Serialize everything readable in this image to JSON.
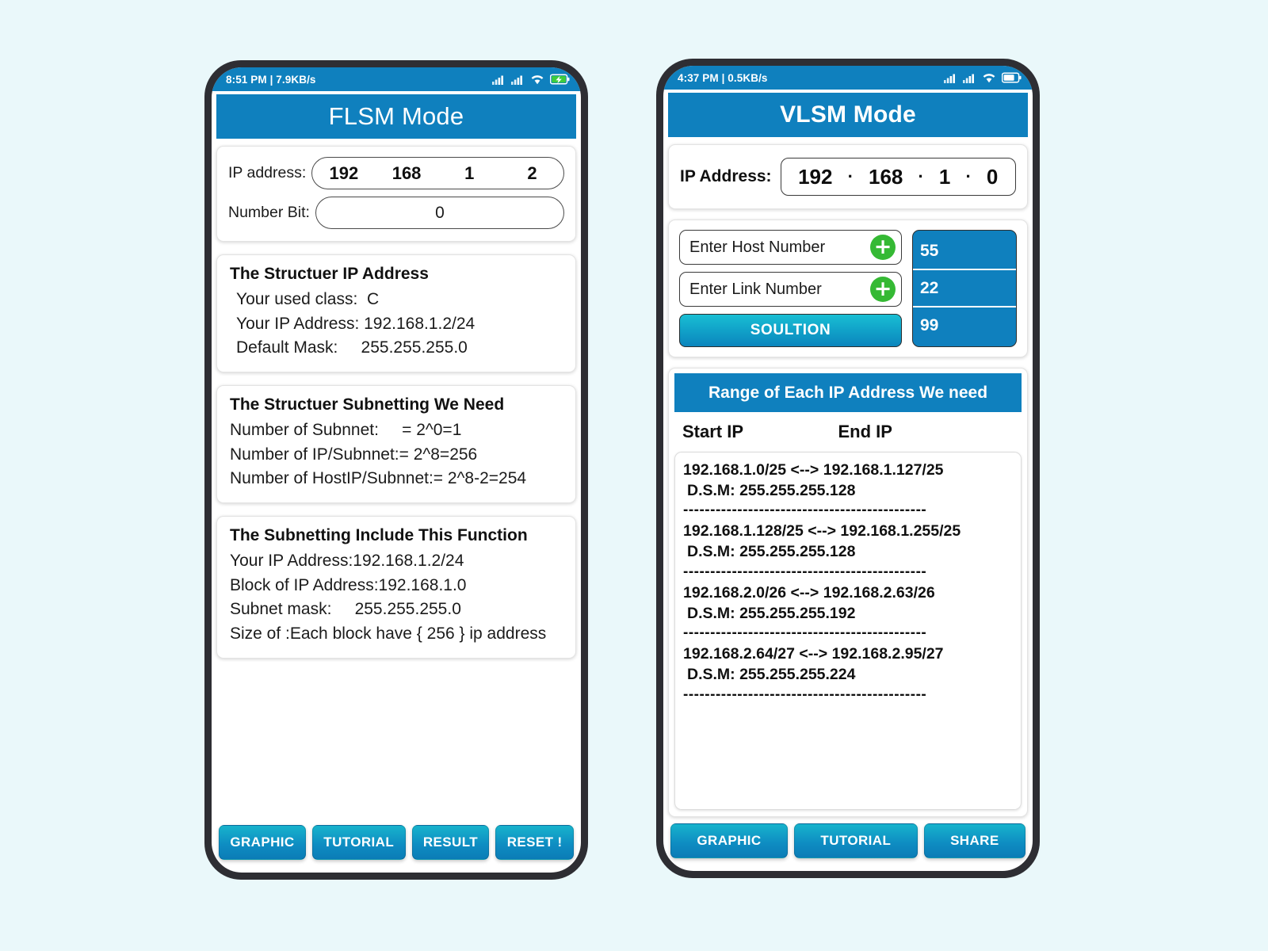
{
  "background_color": "#eaf8fa",
  "accent_blue": "#0f80be",
  "button_gradient": [
    "#17b3cc",
    "#0b7cb6"
  ],
  "green_plus": "#35b934",
  "phone_flsm": {
    "status_bar": {
      "left_text": "8:51 PM | 7.9KB/s",
      "icons": [
        "signal-icon",
        "signal-icon",
        "wifi-icon",
        "battery-charging-icon"
      ]
    },
    "appbar_title": "FLSM Mode",
    "input_card": {
      "ip_label": "IP address:",
      "ip_octets": [
        "192",
        "168",
        "1",
        "2"
      ],
      "numberbit_label": "Number Bit:",
      "numberbit_value": "0"
    },
    "card_structure_ip": {
      "title": "The Structuer IP Address",
      "lines": [
        "Your used class:  C",
        "Your IP Address: 192.168.1.2/24",
        "Default Mask:     255.255.255.0"
      ]
    },
    "card_structure_subnetting": {
      "title": "The Structuer Subnetting We Need",
      "lines": [
        "Number of Subnnet:     = 2^0=1",
        "Number of IP/Subnnet:= 2^8=256",
        "Number of HostIP/Subnnet:= 2^8-2=254"
      ]
    },
    "card_include_function": {
      "title": "The Subnetting Include This Function",
      "lines": [
        "Your IP Address:192.168.1.2/24",
        "Block of IP Address:192.168.1.0",
        "Subnet mask:     255.255.255.0",
        "Size of :Each block have { 256 } ip address"
      ]
    },
    "buttons": [
      "GRAPHIC",
      "TUTORIAL",
      "RESULT",
      "RESET !"
    ]
  },
  "phone_vlsm": {
    "status_bar": {
      "left_text": "4:37 PM | 0.5KB/s",
      "icons": [
        "signal-icon",
        "signal-icon",
        "wifi-icon",
        "battery-icon"
      ]
    },
    "appbar_title": "VLSM Mode",
    "ip_card": {
      "label": "IP Address:",
      "octets": [
        "192",
        "168",
        "1",
        "0"
      ],
      "separator": "·"
    },
    "entry_card": {
      "host_placeholder": "Enter Host Number",
      "link_placeholder": "Enter Link Number",
      "add_symbol": "+",
      "solution_label": "SOULTION",
      "numbers": [
        "55",
        "22",
        "99"
      ]
    },
    "range_card": {
      "header": "Range of Each IP Address We need",
      "col_start": "Start IP",
      "col_end": "End IP",
      "separator": "---------------------------------------------",
      "items": [
        {
          "range": "192.168.1.0/25 <--> 192.168.1.127/25",
          "dsm": "D.S.M: 255.255.255.128"
        },
        {
          "range": "192.168.1.128/25 <--> 192.168.1.255/25",
          "dsm": "D.S.M: 255.255.255.128"
        },
        {
          "range": "192.168.2.0/26 <--> 192.168.2.63/26",
          "dsm": "D.S.M: 255.255.255.192"
        },
        {
          "range": "192.168.2.64/27 <--> 192.168.2.95/27",
          "dsm": "D.S.M: 255.255.255.224"
        }
      ]
    },
    "buttons": [
      "GRAPHIC",
      "TUTORIAL",
      "SHARE"
    ]
  }
}
